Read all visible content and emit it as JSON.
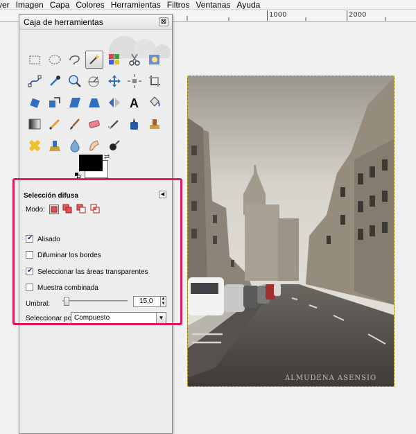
{
  "menubar": {
    "items": [
      "ver",
      "Imagen",
      "Capa",
      "Colores",
      "Herramientas",
      "Filtros",
      "Ventanas",
      "Ayuda"
    ]
  },
  "ruler": {
    "labels": [
      "1000",
      "2000"
    ]
  },
  "toolbox": {
    "title": "Caja de herramientas",
    "close_label": "⊠",
    "tool_icons": [
      "rect-select-icon",
      "ellipse-select-icon",
      "free-select-icon",
      "fuzzy-select-icon",
      "select-by-color-icon",
      "scissors-select-icon",
      "foreground-select-icon",
      "paths-icon",
      "color-picker-icon",
      "zoom-icon",
      "measure-icon",
      "move-icon",
      "align-icon",
      "crop-icon",
      "rotate-icon",
      "scale-icon",
      "shear-icon",
      "perspective-icon",
      "flip-icon",
      "text-icon",
      "bucket-fill-icon",
      "blend-icon",
      "pencil-icon",
      "paintbrush-icon",
      "eraser-icon",
      "airbrush-icon",
      "ink-icon",
      "clone-icon",
      "heal-icon",
      "perspective-clone-icon",
      "blur-icon",
      "smudge-icon",
      "dodge-burn-icon"
    ],
    "active_tool": "fuzzy-select-icon",
    "colors": {
      "foreground": "#000000",
      "background": "#ffffff"
    }
  },
  "tool_options": {
    "title": "Selección difusa",
    "mode_label": "Modo:",
    "mode_icons": [
      "replace-mode-icon",
      "add-mode-icon",
      "subtract-mode-icon",
      "intersect-mode-icon"
    ],
    "checkboxes": [
      {
        "label": "Alisado",
        "checked": true
      },
      {
        "label": "Difuminar los bordes",
        "checked": false
      },
      {
        "label": "Seleccionar las áreas transparentes",
        "checked": true
      },
      {
        "label": "Muestra combinada",
        "checked": false
      }
    ],
    "threshold_label": "Umbral:",
    "threshold_value": "15,0",
    "threshold_fraction": 0.06,
    "select_by_label": "Seleccionar por:",
    "select_by_value": "Compuesto"
  },
  "highlight_color": "#e0195c",
  "photo": {
    "watermark": "ALMUDENA ASENSIO"
  }
}
